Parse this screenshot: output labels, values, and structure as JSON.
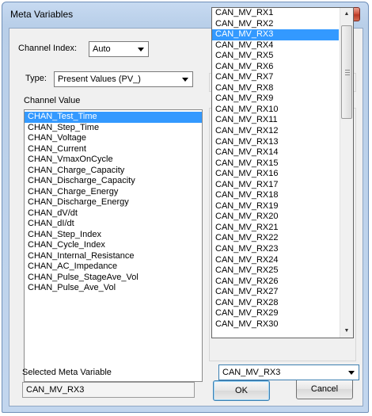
{
  "window": {
    "title": "Meta Variables",
    "close_glyph": "X"
  },
  "channel_index": {
    "label": "Channel Index:",
    "value": "Auto"
  },
  "type": {
    "label": "Type:",
    "value": "Present Values (PV_)"
  },
  "channel_value": {
    "label": "Channel Value",
    "items": [
      "CHAN_Test_Time",
      "CHAN_Step_Time",
      "CHAN_Voltage",
      "CHAN_Current",
      "CHAN_VmaxOnCycle",
      "CHAN_Charge_Capacity",
      "CHAN_Discharge_Capacity",
      "CHAN_Charge_Energy",
      "CHAN_Discharge_Energy",
      "CHAN_dV/dt",
      "CHAN_dI/dt",
      "CHAN_Step_Index",
      "CHAN_Cycle_Index",
      "CHAN_Internal_Resistance",
      "CHAN_AC_Impedance",
      "CHAN_Pulse_StageAve_Vol",
      "CHAN_Pulse_Ave_Vol"
    ],
    "selected_index": 0
  },
  "selected_meta_variable": {
    "label": "Selected Meta Variable",
    "value": "CAN_MV_RX3"
  },
  "buttons": {
    "ok": "OK",
    "cancel": "Cancel"
  },
  "can_dropdown": {
    "value": "CAN_MV_RX3",
    "selected_index": 2,
    "options": [
      "CAN_MV_RX1",
      "CAN_MV_RX2",
      "CAN_MV_RX3",
      "CAN_MV_RX4",
      "CAN_MV_RX5",
      "CAN_MV_RX6",
      "CAN_MV_RX7",
      "CAN_MV_RX8",
      "CAN_MV_RX9",
      "CAN_MV_RX10",
      "CAN_MV_RX11",
      "CAN_MV_RX12",
      "CAN_MV_RX13",
      "CAN_MV_RX14",
      "CAN_MV_RX15",
      "CAN_MV_RX16",
      "CAN_MV_RX17",
      "CAN_MV_RX18",
      "CAN_MV_RX19",
      "CAN_MV_RX20",
      "CAN_MV_RX21",
      "CAN_MV_RX22",
      "CAN_MV_RX23",
      "CAN_MV_RX24",
      "CAN_MV_RX25",
      "CAN_MV_RX26",
      "CAN_MV_RX27",
      "CAN_MV_RX28",
      "CAN_MV_RX29",
      "CAN_MV_RX30"
    ],
    "scroll_up_glyph": "▲",
    "scroll_down_glyph": "▼"
  },
  "colors": {
    "selection": "#3399ff",
    "title_bar": "#b9cfe9",
    "close_button": "#c8452e"
  }
}
